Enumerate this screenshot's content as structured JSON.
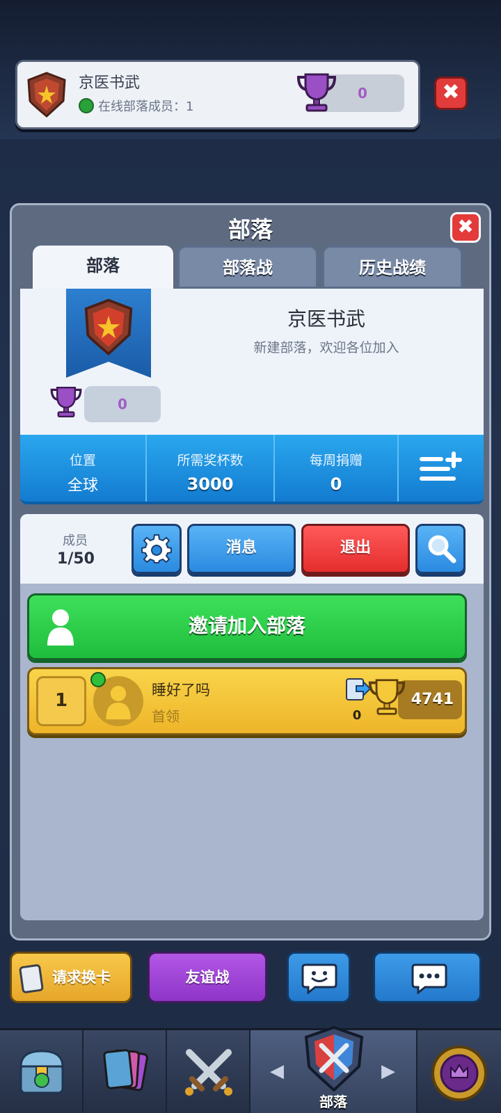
{
  "topbar": {
    "clan_name": "京医书武",
    "online_label": "在线部落成员：1",
    "trophies": "0",
    "close_icon": "close-icon"
  },
  "panel": {
    "title": "部落",
    "tabs": [
      {
        "label": "部落",
        "active": true
      },
      {
        "label": "部落战",
        "active": false
      },
      {
        "label": "历史战绩",
        "active": false
      }
    ]
  },
  "clan": {
    "name": "京医书武",
    "description": "新建部落，欢迎各位加入",
    "trophies": "0"
  },
  "stats": {
    "location_label": "位置",
    "location_value": "全球",
    "required_label": "所需奖杯数",
    "required_value": "3000",
    "donation_label": "每周捐赠",
    "donation_value": "0"
  },
  "members": {
    "label": "成员",
    "count": "1/50",
    "message_button": "消息",
    "leave_button": "退出",
    "invite_button": "邀请加入部落",
    "list": [
      {
        "rank": "1",
        "name": "睡好了吗",
        "role": "首领",
        "donations": "0",
        "trophies": "4741",
        "online": true
      }
    ]
  },
  "actions": {
    "request_cards": "请求换卡",
    "friendly_battle": "友谊战"
  },
  "nav": {
    "clan_label": "部落"
  },
  "colors": {
    "green_button": "#1fbd3c",
    "red_button": "#e52d2d",
    "blue_button": "#2a8ae0",
    "leader_row": "#eeb529",
    "stats_bar": "#137bd0"
  }
}
